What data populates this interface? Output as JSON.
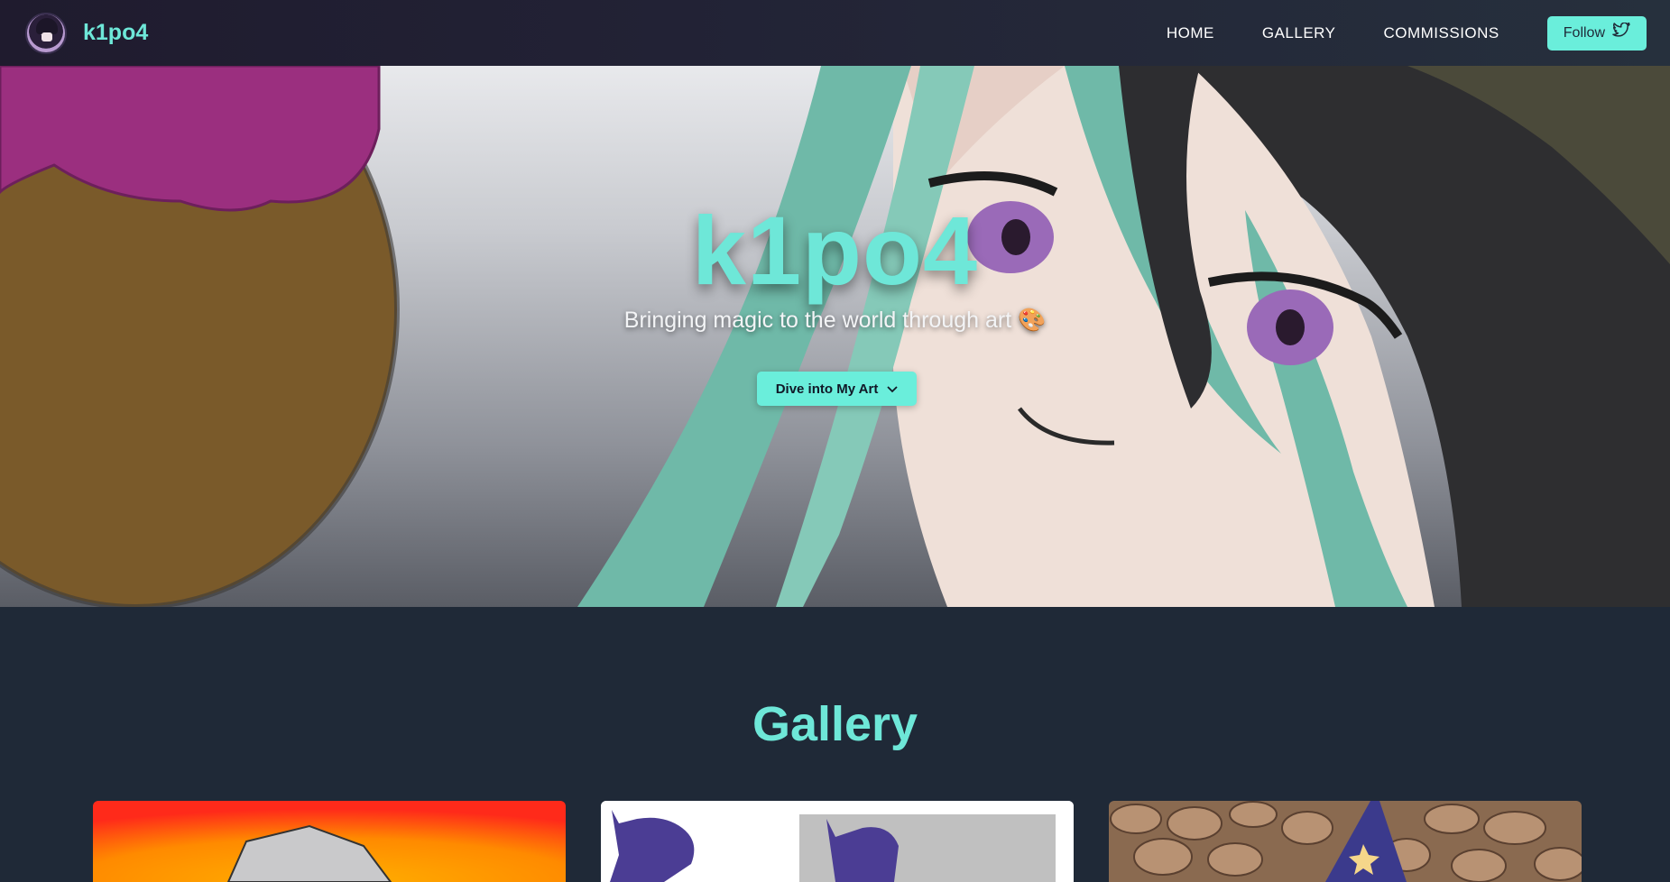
{
  "navbar": {
    "brand_name": "k1po4",
    "links": [
      "HOME",
      "GALLERY",
      "COMMISSIONS"
    ],
    "follow_label": "Follow",
    "follow_icon": "twitter-bird-icon"
  },
  "hero": {
    "title": "k1po4",
    "subtitle": "Bringing magic to the world through art 🎨",
    "cta_label": "Dive into My Art",
    "cta_icon": "chevron-down-icon"
  },
  "gallery": {
    "title": "Gallery",
    "cards": [
      "orange-artwork",
      "purple-sketch-artwork",
      "stone-wall-wizard-artwork"
    ]
  },
  "colors": {
    "accent": "#6aeedb",
    "background": "#1f2937",
    "navbar": "#222235"
  }
}
